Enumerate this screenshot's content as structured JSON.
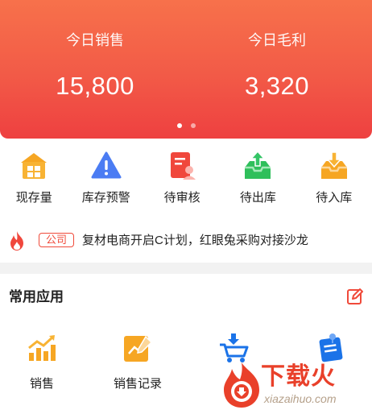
{
  "stats": {
    "sales": {
      "label": "今日销售",
      "value": "15,800"
    },
    "profit": {
      "label": "今日毛利",
      "value": "3,320"
    }
  },
  "carousel": {
    "pages": 2,
    "active": 1
  },
  "quick_actions": [
    {
      "label": "现存量",
      "icon": "warehouse-icon",
      "color": "#f6a623"
    },
    {
      "label": "库存预警",
      "icon": "warning-icon",
      "color": "#4b7cf3"
    },
    {
      "label": "待审核",
      "icon": "review-document-icon",
      "color": "#f0473c"
    },
    {
      "label": "待出库",
      "icon": "outbound-tray-icon",
      "color": "#2fbf5b"
    },
    {
      "label": "待入库",
      "icon": "inbound-tray-icon",
      "color": "#f6a623"
    }
  ],
  "notice": {
    "tag": "公司",
    "message": "复材电商开启C计划，红眼兔采购对接沙龙"
  },
  "common_apps": {
    "title": "常用应用",
    "items": [
      {
        "label": "销售",
        "icon": "bar-chart-icon"
      },
      {
        "label": "销售记录",
        "icon": "sales-record-icon"
      },
      {
        "label": "",
        "icon": "cart-download-icon"
      },
      {
        "label": "",
        "icon": "clipboard-pin-icon"
      }
    ]
  },
  "watermark": {
    "text": "下载火",
    "url": "xiazaihuo.com"
  },
  "colors": {
    "accent": "#f25a47",
    "tag_red": "#f04a3a",
    "app_orange": "#f6a623",
    "app_blue": "#1b73e8"
  }
}
